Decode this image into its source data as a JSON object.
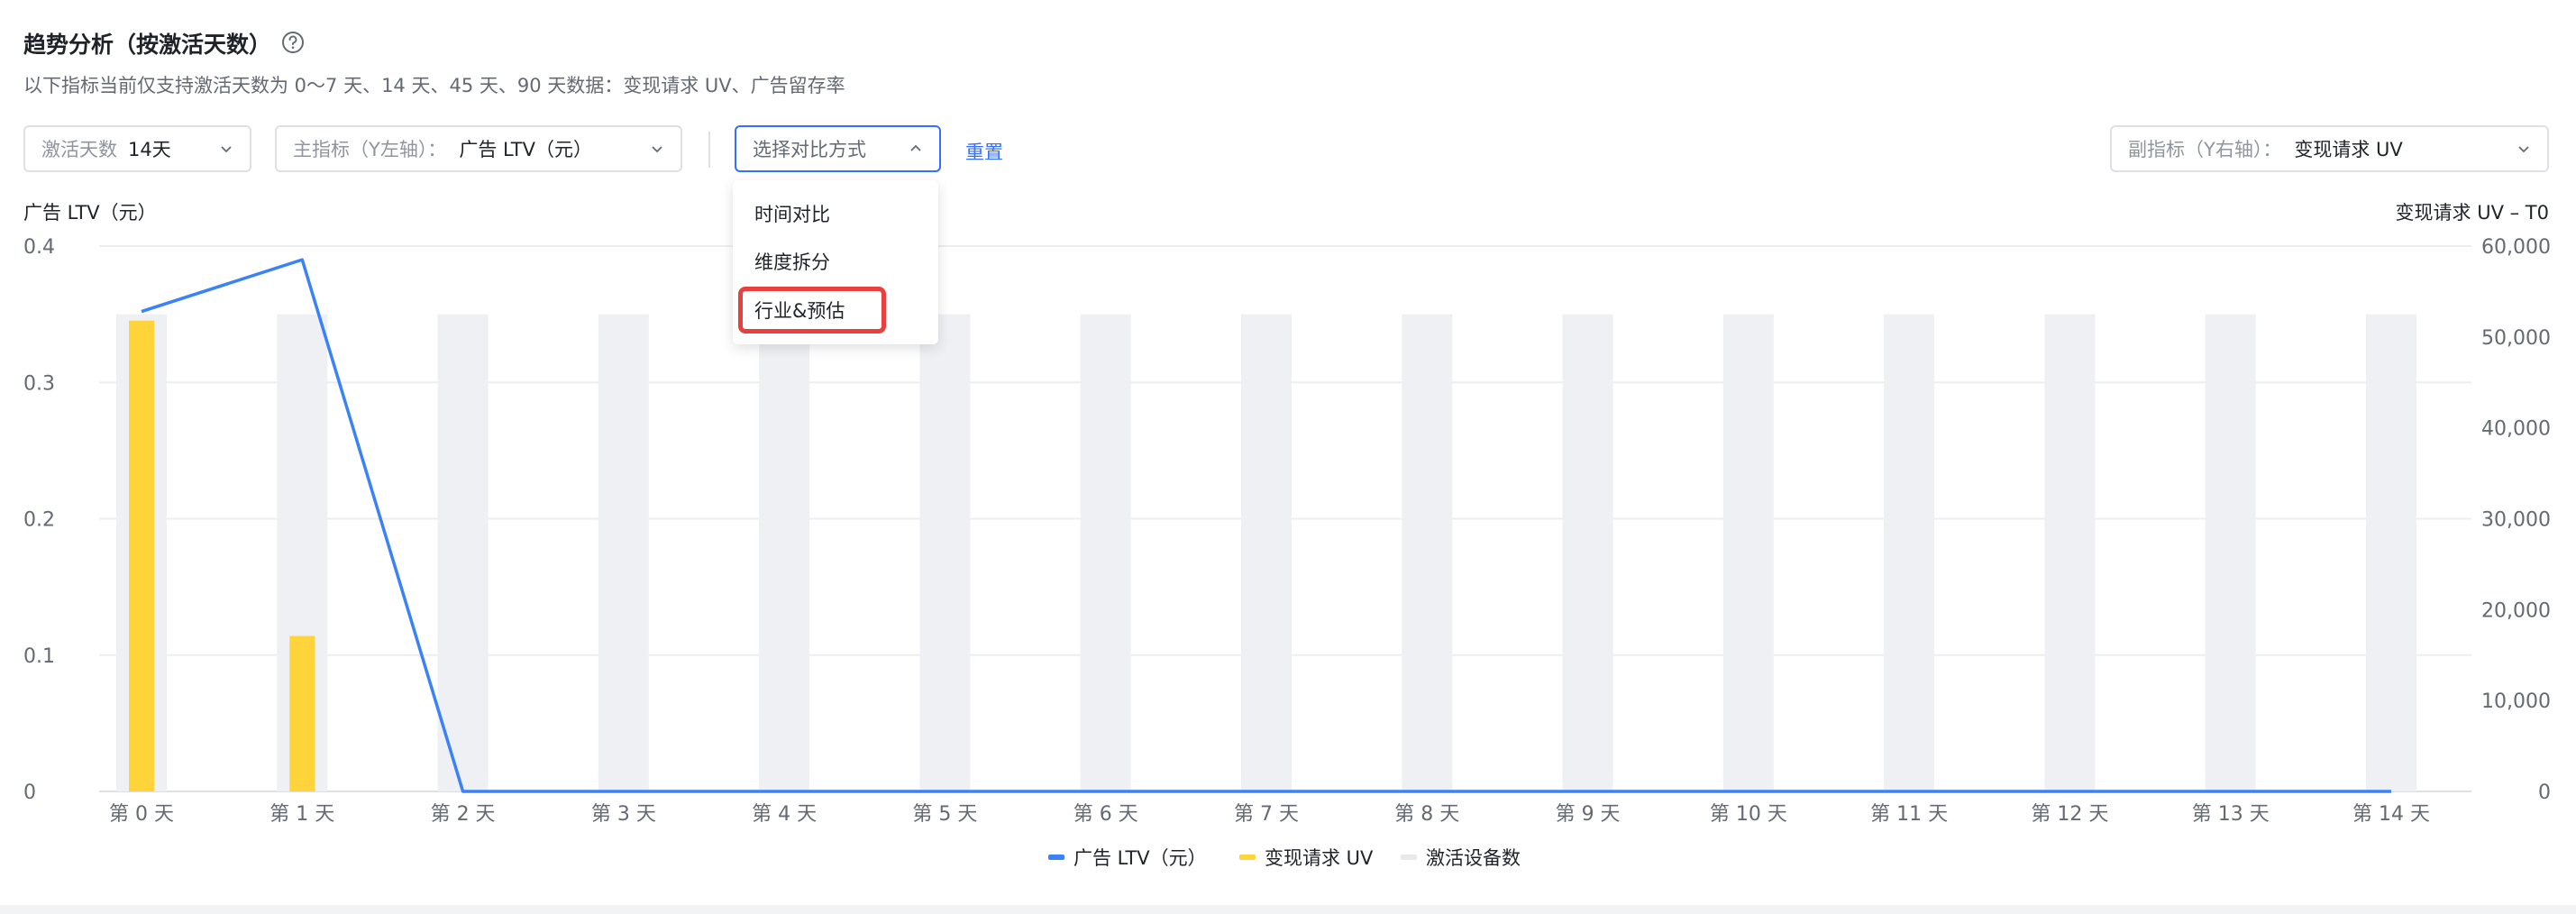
{
  "header": {
    "title": "趋势分析（按激活天数）",
    "subtitle": "以下指标当前仅支持激活天数为 0～7 天、14 天、45 天、90 天数据：变现请求 UV、广告留存率"
  },
  "filters": {
    "days_label": "激活天数",
    "days_value": "14天",
    "primary_label": "主指标（Y左轴）：",
    "primary_value": "广告 LTV（元）",
    "compare_placeholder": "选择对比方式",
    "reset_label": "重置",
    "secondary_label": "副指标（Y右轴）：",
    "secondary_value": "变现请求 UV"
  },
  "dropdown": {
    "items": [
      "时间对比",
      "维度拆分",
      "行业&预估"
    ],
    "highlighted_index": 2,
    "highlight_color": "#e8403e"
  },
  "colors": {
    "line": "#3b82f6",
    "uv_bar": "#ffd43b",
    "device_bar": "#eff0f4",
    "accent": "#3370ff"
  },
  "chart_data": {
    "type": "bar",
    "categories": [
      "第 0 天",
      "第 1 天",
      "第 2 天",
      "第 3 天",
      "第 4 天",
      "第 5 天",
      "第 6 天",
      "第 7 天",
      "第 8 天",
      "第 9 天",
      "第 10 天",
      "第 11 天",
      "第 12 天",
      "第 13 天",
      "第 14 天"
    ],
    "y_left": {
      "label": "广告 LTV（元）",
      "ticks": [
        "0",
        "0.1",
        "0.2",
        "0.3",
        "0.4"
      ],
      "range": [
        0,
        0.4
      ]
    },
    "y_right": {
      "label": "变现请求 UV – T0",
      "ticks": [
        "0",
        "10,000",
        "20,000",
        "30,000",
        "40,000",
        "50,000",
        "60,000"
      ],
      "range": [
        0,
        60000
      ]
    },
    "grid": true,
    "legend_position": "bottom",
    "series": [
      {
        "name": "广告 LTV（元）",
        "type": "line",
        "axis": "left",
        "values": [
          0.352,
          0.39,
          0,
          0,
          0,
          0,
          0,
          0,
          0,
          0,
          0,
          0,
          0,
          0,
          0
        ]
      },
      {
        "name": "变现请求 UV",
        "type": "bar",
        "axis": "right",
        "values": [
          51800,
          17100,
          0,
          0,
          0,
          0,
          0,
          0,
          0,
          0,
          0,
          0,
          0,
          0,
          0
        ]
      },
      {
        "name": "激活设备数",
        "type": "bar",
        "axis": "right",
        "values": [
          52500,
          52500,
          52500,
          52500,
          52500,
          52500,
          52500,
          52500,
          52500,
          52500,
          52500,
          52500,
          52500,
          52500,
          52500
        ]
      }
    ]
  }
}
